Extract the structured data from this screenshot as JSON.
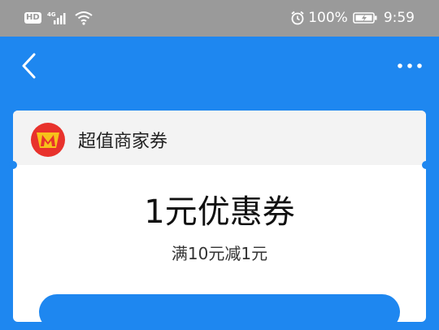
{
  "status_bar": {
    "hd": "HD",
    "network": "4G",
    "battery_percent": "100%",
    "time": "9:59"
  },
  "nav": {
    "back_icon": "chevron-left-icon",
    "more_icon": "more-horizontal-icon"
  },
  "merchant": {
    "name": "超值商家券",
    "logo_icon": "m-logo-icon"
  },
  "coupon": {
    "title": "1元优惠券",
    "condition": "满10元减1元"
  },
  "colors": {
    "primary": "#1e87f0",
    "status_bar": "#9a9a9a",
    "card_header": "#f3f3f3",
    "logo_red": "#e8322c",
    "logo_yellow": "#f7c21a"
  }
}
